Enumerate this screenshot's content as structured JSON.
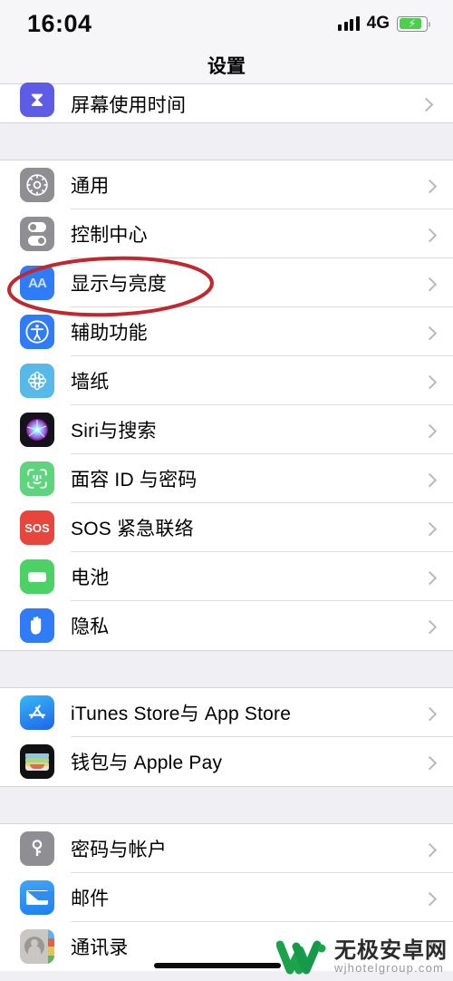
{
  "status_bar": {
    "time": "16:04",
    "network": "4G",
    "signal_icon": "signal-bars-icon",
    "battery_icon": "battery-charging-icon",
    "battery_charging": true
  },
  "nav": {
    "title": "设置"
  },
  "groups": [
    {
      "id": "group-screentime",
      "rows": [
        {
          "label": "屏幕使用时间",
          "icon": "hourglass-icon",
          "icon_class": "ic-screentime",
          "clipped": true
        }
      ]
    },
    {
      "id": "group-system",
      "rows": [
        {
          "label": "通用",
          "icon": "gear-icon",
          "icon_class": "ic-general"
        },
        {
          "label": "控制中心",
          "icon": "toggles-icon",
          "icon_class": "ic-control"
        },
        {
          "label": "显示与亮度",
          "icon": "aa-text-icon",
          "icon_class": "ic-display",
          "highlighted": true
        },
        {
          "label": "辅助功能",
          "icon": "accessibility-icon",
          "icon_class": "ic-access"
        },
        {
          "label": "墙纸",
          "icon": "flower-icon",
          "icon_class": "ic-wallpaper"
        },
        {
          "label": "Siri与搜索",
          "icon": "siri-orb-icon",
          "icon_class": "ic-siri"
        },
        {
          "label": "面容 ID 与密码",
          "icon": "face-id-icon",
          "icon_class": "ic-faceid"
        },
        {
          "label": "SOS 紧急联络",
          "icon": "sos-icon",
          "icon_class": "ic-sos"
        },
        {
          "label": "电池",
          "icon": "battery-icon",
          "icon_class": "ic-battery"
        },
        {
          "label": "隐私",
          "icon": "hand-icon",
          "icon_class": "ic-privacy"
        }
      ]
    },
    {
      "id": "group-stores",
      "rows": [
        {
          "label": "iTunes Store与 App Store",
          "icon": "app-store-icon",
          "icon_class": "ic-appstore"
        },
        {
          "label": "钱包与 Apple Pay",
          "icon": "wallet-icon",
          "icon_class": "ic-wallet"
        }
      ]
    },
    {
      "id": "group-accounts",
      "rows": [
        {
          "label": "密码与帐户",
          "icon": "key-icon",
          "icon_class": "ic-passwords"
        },
        {
          "label": "邮件",
          "icon": "envelope-icon",
          "icon_class": "ic-mail"
        },
        {
          "label": "通讯录",
          "icon": "contacts-icon",
          "icon_class": "ic-contacts"
        }
      ]
    }
  ],
  "annotation": {
    "shape": "ellipse",
    "color": "#c1272d",
    "targets_row": "显示与亮度"
  },
  "watermark": {
    "logo": "w-logo-icon",
    "name": "无极安卓网",
    "url": "wjhotelgroup.com",
    "logo_color": "#1aa34a"
  },
  "home_indicator": "home-indicator-bar",
  "colors": {
    "accent_blue": "#2f7cf6",
    "group_background": "#efeff4",
    "row_background": "#ffffff",
    "separator": "#dcdce0",
    "chevron": "#b9b9bd"
  }
}
